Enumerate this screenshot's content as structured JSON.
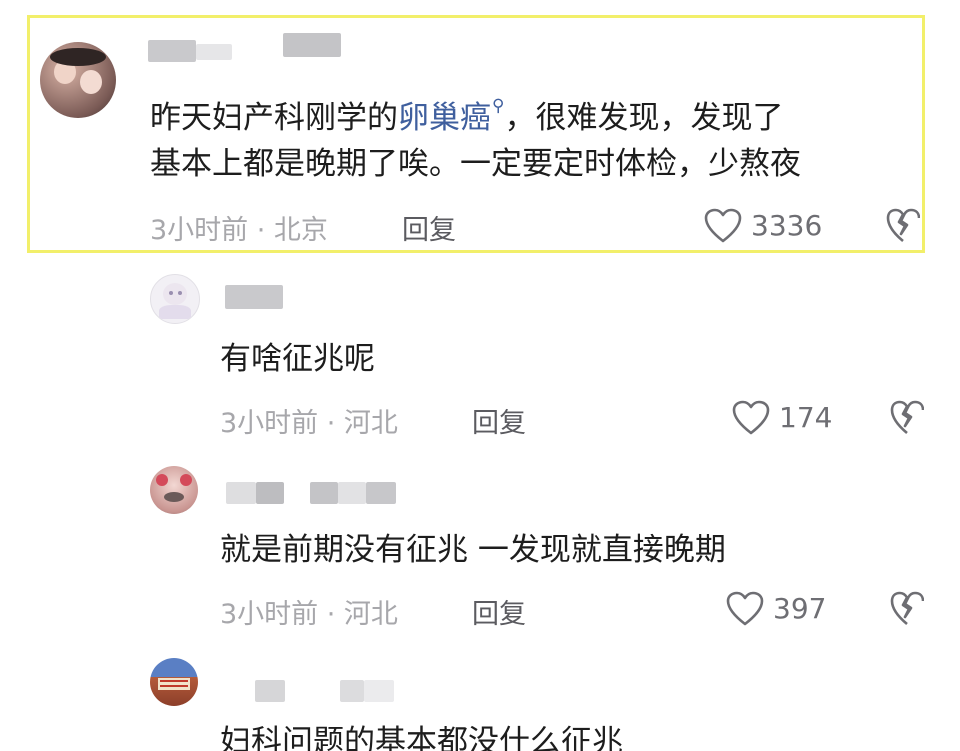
{
  "comments": [
    {
      "text_line1_a": "昨天妇产科刚学的",
      "text_link": "卵巢癌",
      "text_line1_b": "，很难发现，发现了",
      "text_line2": "基本上都是晚期了唉。一定要定时体检，少熬夜",
      "meta": "3小时前 · 北京",
      "reply_label": "回复",
      "likes": "3336"
    },
    {
      "text": "有啥征兆呢",
      "meta": "3小时前 · 河北",
      "reply_label": "回复",
      "likes": "174"
    },
    {
      "text": "就是前期没有征兆 一发现就直接晚期",
      "meta": "3小时前 · 河北",
      "reply_label": "回复",
      "likes": "397"
    },
    {
      "text": "妇科问题的基本都没什么征兆"
    }
  ],
  "icons": {
    "like": "heart-icon",
    "dislike": "broken-heart-icon",
    "search": "search-icon"
  },
  "colors": {
    "highlight_border": "#f2ef6a",
    "link": "#3f5f9e",
    "meta": "#a7a7ab"
  }
}
